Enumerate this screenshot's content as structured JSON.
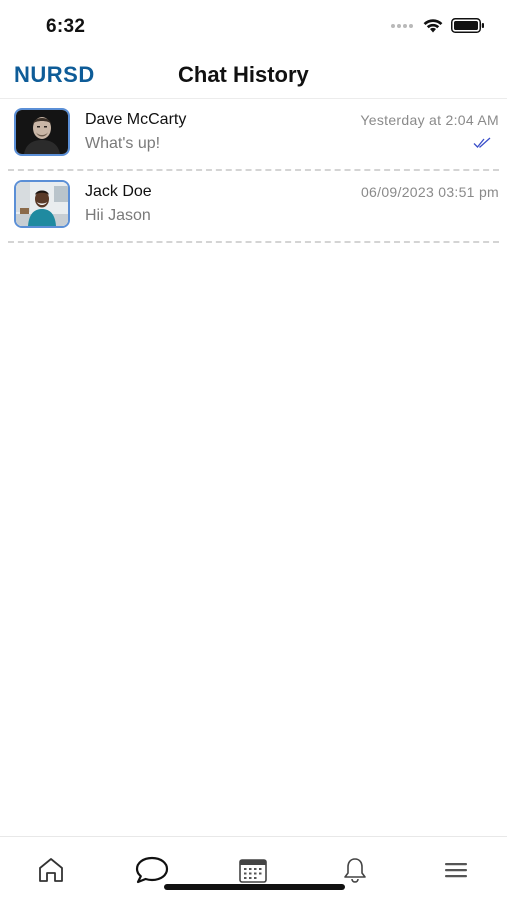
{
  "status_bar": {
    "time": "6:32"
  },
  "header": {
    "brand": "NURSD",
    "title": "Chat History"
  },
  "chats": [
    {
      "name": "Dave McCarty",
      "preview": "What's up!",
      "time": "Yesterday at 2:04 AM",
      "read_icon": "double-check-icon"
    },
    {
      "name": "Jack Doe",
      "preview": "Hii Jason",
      "time": "06/09/2023 03:51 pm"
    }
  ],
  "tab_bar": {
    "items": [
      "home-icon",
      "chat-bubble-icon",
      "calendar-icon",
      "bell-icon",
      "menu-icon"
    ],
    "active": "chat-bubble-icon"
  },
  "colors": {
    "brand": "#0e5c98",
    "avatar_border": "#5b8fd6",
    "read_check": "#3a4fc9"
  }
}
